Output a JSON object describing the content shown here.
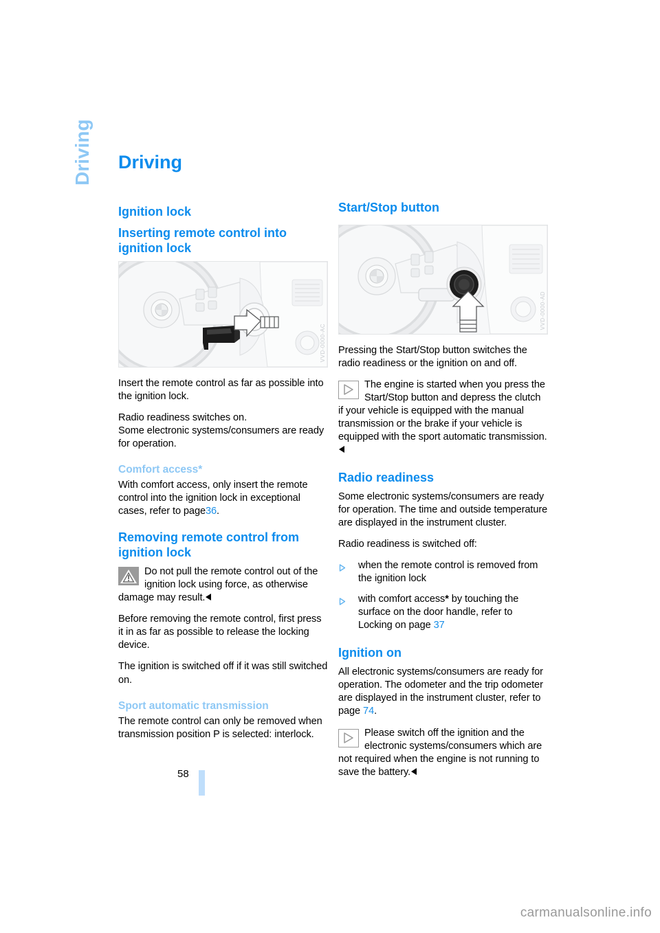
{
  "chapter_tab": "Driving",
  "page_title": "Driving",
  "page_number": "58",
  "watermark": "carmanualsonline.info",
  "colors": {
    "heading_blue": "#0c8ced",
    "subheading_blue": "#8ec8f5",
    "link_blue": "#1a8fe8",
    "page_marker": "#bfdefb"
  },
  "left_column": {
    "section_heading": "Ignition lock",
    "sub1": {
      "heading": "Inserting remote control into ignition lock",
      "figure_alt": "Steering wheel with remote control inserted into ignition lock",
      "figure_code": "VVD-0000-AC",
      "p1": "Insert the remote control as far as possible into the ignition lock.",
      "p2_line1": "Radio readiness switches on.",
      "p2_line2": "Some electronic systems/consumers are ready for operation."
    },
    "sub2": {
      "heading": "Comfort access*",
      "p1_before": "With comfort access, only insert the remote control into the ignition lock in exceptional cases, refer to page",
      "p1_link": "36",
      "p1_after": "."
    },
    "sub3": {
      "heading": "Removing remote control from ignition lock",
      "warning_icon": "warning-triangle-icon",
      "warning_text": "Do not pull the remote control out of the ignition lock using force, as otherwise damage may result.",
      "p1": "Before removing the remote control, first press it in as far as possible to release the locking device.",
      "p2": "The ignition is switched off if it was still switched on."
    },
    "sub4": {
      "heading": "Sport automatic transmission",
      "p1": "The remote control can only be removed when transmission position P is selected: interlock."
    }
  },
  "right_column": {
    "section_heading": "Start/Stop button",
    "figure_alt": "Steering wheel with Start/Stop button and arrow indicating press",
    "figure_code": "VVD-0000-AD",
    "p1": "Pressing the Start/Stop button switches the radio readiness or the ignition on and off.",
    "note1": {
      "icon": "note-play-icon",
      "text": "The engine is started when you press the Start/Stop button and depress the clutch if your vehicle is equipped with the manual transmission or the brake if your vehicle is equipped with the sport automatic transmission."
    },
    "sub1": {
      "heading": "Radio readiness",
      "p1": "Some electronic systems/consumers are ready for operation. The time and outside temperature are displayed in the instrument cluster.",
      "p2": "Radio readiness is switched off:",
      "bullets": [
        {
          "text": "when the remote control is removed from the ignition lock"
        },
        {
          "before": "with comfort access",
          "star": "*",
          "middle": " by touching the surface on the door handle, refer to Locking on page ",
          "link": "37"
        }
      ]
    },
    "sub2": {
      "heading": "Ignition on",
      "p1_before": "All electronic systems/consumers are ready for operation. The odometer and the trip odometer are displayed in the instrument cluster, refer to page",
      "p1_link": "74",
      "p1_after": ".",
      "note": {
        "icon": "note-play-icon",
        "text": "Please switch off the ignition and the electronic systems/consumers which are not required when the engine is not running to save the battery."
      }
    }
  }
}
